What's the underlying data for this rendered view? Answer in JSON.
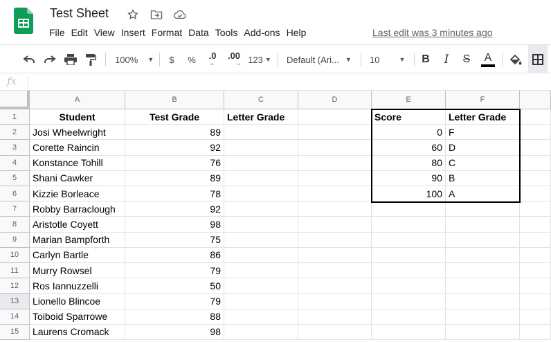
{
  "app": {
    "title": "Test Sheet",
    "menu": [
      "File",
      "Edit",
      "View",
      "Insert",
      "Format",
      "Data",
      "Tools",
      "Add-ons",
      "Help"
    ],
    "last_edit": "Last edit was 3 minutes ago"
  },
  "toolbar": {
    "zoom": "100%",
    "currency": "$",
    "percent": "%",
    "decrease_decimals": ".0",
    "increase_decimals": ".00",
    "more_formats": "123",
    "font": "Default (Ari...",
    "font_size": "10",
    "bold": "B",
    "italic": "I",
    "strikethrough": "S",
    "text_color": "A"
  },
  "formula_bar": {
    "fx": "fx",
    "value": ""
  },
  "sheet": {
    "columns": [
      "A",
      "B",
      "C",
      "D",
      "E",
      "F"
    ],
    "rows": [
      "1",
      "2",
      "3",
      "4",
      "5",
      "6",
      "7",
      "8",
      "9",
      "10",
      "11",
      "12",
      "13",
      "14",
      "15"
    ],
    "headers": {
      "a": "Student",
      "b": "Test Grade",
      "c": "Letter Grade",
      "e": "Score",
      "f": "Letter Grade"
    },
    "students": [
      {
        "name": "Josi Wheelwright",
        "grade": "89"
      },
      {
        "name": "Corette Raincin",
        "grade": "92"
      },
      {
        "name": "Konstance Tohill",
        "grade": "76"
      },
      {
        "name": "Shani Cawker",
        "grade": "89"
      },
      {
        "name": "Kizzie Borleace",
        "grade": "78"
      },
      {
        "name": "Robby Barraclough",
        "grade": "92"
      },
      {
        "name": "Aristotle Coyett",
        "grade": "98"
      },
      {
        "name": "Marian Bampforth",
        "grade": "75"
      },
      {
        "name": "Carlyn Bartle",
        "grade": "86"
      },
      {
        "name": "Murry Rowsel",
        "grade": "79"
      },
      {
        "name": "Ros Iannuzzelli",
        "grade": "50"
      },
      {
        "name": "Lionello Blincoe",
        "grade": "79"
      },
      {
        "name": "Toiboid Sparrowe",
        "grade": "88"
      },
      {
        "name": "Laurens Cromack",
        "grade": "98"
      }
    ],
    "lookup": [
      {
        "score": "0",
        "letter": "F"
      },
      {
        "score": "60",
        "letter": "D"
      },
      {
        "score": "80",
        "letter": "C"
      },
      {
        "score": "90",
        "letter": "B"
      },
      {
        "score": "100",
        "letter": "A"
      }
    ],
    "selected_row": "13"
  },
  "colors": {
    "sheets_green": "#0f9d58",
    "link_gray": "#5f6368",
    "header_bg": "#f8f9fa"
  }
}
